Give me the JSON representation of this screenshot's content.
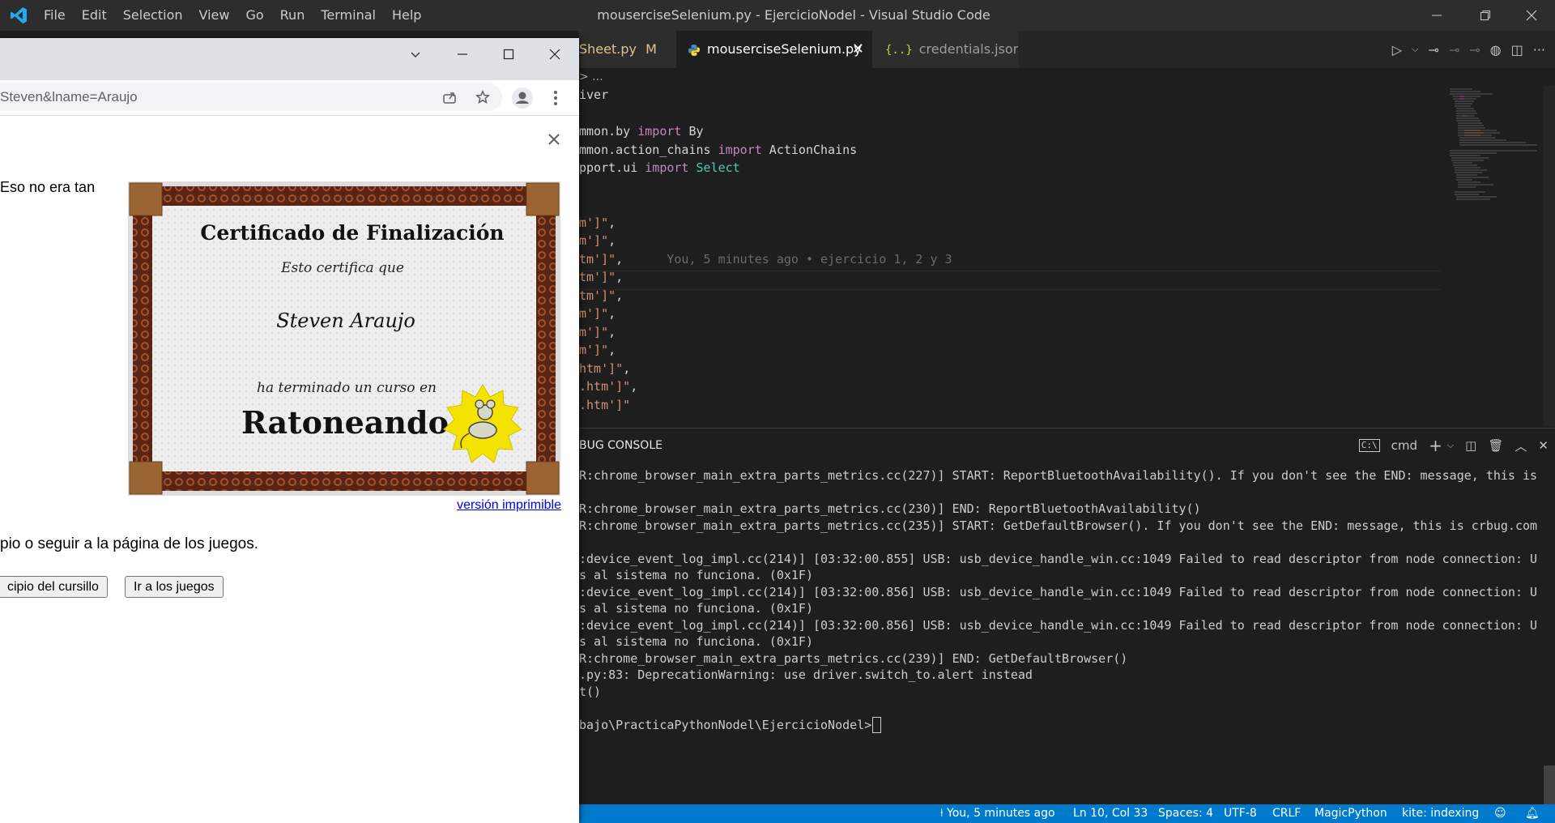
{
  "vscode": {
    "menu": [
      "File",
      "Edit",
      "Selection",
      "View",
      "Go",
      "Run",
      "Terminal",
      "Help"
    ],
    "window_title": "mouserciseSelenium.py - EjercicioNodel - Visual Studio Code",
    "tabs": [
      {
        "label": "Sheet.py",
        "badge": "M"
      },
      {
        "label": "mouserciseSelenium.py"
      },
      {
        "label": "credentials.json"
      }
    ],
    "breadcrumb": "> ...",
    "code_lines": [
      {
        "text": "iver",
        "tokens": [
          {
            "t": "iver",
            "c": ""
          }
        ]
      },
      {
        "text": "",
        "tokens": []
      },
      {
        "text": "mmon.by import By",
        "tokens": [
          {
            "t": "mmon.by ",
            "c": ""
          },
          {
            "t": "import",
            "c": "kw"
          },
          {
            "t": " By",
            "c": ""
          }
        ]
      },
      {
        "text": "mmon.action_chains import ActionChains",
        "tokens": [
          {
            "t": "mmon.action_chains ",
            "c": ""
          },
          {
            "t": "import",
            "c": "kw"
          },
          {
            "t": " ActionChains",
            "c": ""
          }
        ]
      },
      {
        "text": "pport.ui import Select",
        "tokens": [
          {
            "t": "pport.ui ",
            "c": ""
          },
          {
            "t": "import",
            "c": "kw"
          },
          {
            "t": " Select",
            "c": "cls"
          }
        ]
      },
      {
        "text": "",
        "tokens": []
      },
      {
        "text": "",
        "tokens": []
      },
      {
        "text": "m']\",",
        "tokens": [
          {
            "t": "m']\"",
            "c": "str"
          },
          {
            "t": ",",
            "c": ""
          }
        ]
      },
      {
        "text": "m']\",",
        "tokens": [
          {
            "t": "m']\"",
            "c": "str"
          },
          {
            "t": ",",
            "c": ""
          }
        ]
      },
      {
        "text": "tm']\",",
        "tokens": [
          {
            "t": "tm']\"",
            "c": "str"
          },
          {
            "t": ",",
            "c": ""
          },
          {
            "t": "      You, 5 minutes ago • ejercicio 1, 2 y 3",
            "c": "blame"
          }
        ]
      },
      {
        "text": "tm']\",",
        "tokens": [
          {
            "t": "tm']\"",
            "c": "str"
          },
          {
            "t": ",",
            "c": ""
          }
        ]
      },
      {
        "text": "tm']\",",
        "tokens": [
          {
            "t": "tm']\"",
            "c": "str"
          },
          {
            "t": ",",
            "c": ""
          }
        ]
      },
      {
        "text": "m']\",",
        "tokens": [
          {
            "t": "m']\"",
            "c": "str"
          },
          {
            "t": ",",
            "c": ""
          }
        ]
      },
      {
        "text": "m']\",",
        "tokens": [
          {
            "t": "m']\"",
            "c": "str"
          },
          {
            "t": ",",
            "c": ""
          }
        ]
      },
      {
        "text": "m']\",",
        "tokens": [
          {
            "t": "m']\"",
            "c": "str"
          },
          {
            "t": ",",
            "c": ""
          }
        ]
      },
      {
        "text": "htm']\",",
        "tokens": [
          {
            "t": "htm']\"",
            "c": "str"
          },
          {
            "t": ",",
            "c": ""
          }
        ]
      },
      {
        "text": ".htm']\",",
        "tokens": [
          {
            "t": ".htm']\"",
            "c": "str"
          },
          {
            "t": ",",
            "c": ""
          }
        ]
      },
      {
        "text": ".htm']\"",
        "tokens": [
          {
            "t": ".htm']\"",
            "c": "str"
          }
        ]
      }
    ],
    "panel_title": "BUG CONSOLE",
    "terminal_name": "cmd",
    "terminal_lines": [
      "R:chrome_browser_main_extra_parts_metrics.cc(227)] START: ReportBluetoothAvailability(). If you don't see the END: message, this is",
      "",
      "R:chrome_browser_main_extra_parts_metrics.cc(230)] END: ReportBluetoothAvailability()",
      "R:chrome_browser_main_extra_parts_metrics.cc(235)] START: GetDefaultBrowser(). If you don't see the END: message, this is crbug.com",
      "",
      ":device_event_log_impl.cc(214)] [03:32:00.855] USB: usb_device_handle_win.cc:1049 Failed to read descriptor from node connection: U",
      "s al sistema no funciona. (0x1F)",
      ":device_event_log_impl.cc(214)] [03:32:00.856] USB: usb_device_handle_win.cc:1049 Failed to read descriptor from node connection: U",
      "s al sistema no funciona. (0x1F)",
      ":device_event_log_impl.cc(214)] [03:32:00.856] USB: usb_device_handle_win.cc:1049 Failed to read descriptor from node connection: U",
      "s al sistema no funciona. (0x1F)",
      "R:chrome_browser_main_extra_parts_metrics.cc(239)] END: GetDefaultBrowser()",
      ".py:83: DeprecationWarning: use driver.switch_to.alert instead",
      "t()",
      "",
      "bajo\\PracticaPythonNodel\\EjercicioNodel>"
    ],
    "status": {
      "blame": "You, 5 minutes ago",
      "position": "Ln 10, Col 33",
      "spaces": "Spaces: 4",
      "encoding": "UTF-8",
      "eol": "CRLF",
      "language": "MagicPython",
      "kite": "kite: indexing"
    },
    "colors": {
      "statusbar": "#007acc",
      "editor_bg": "#1e1e1e",
      "keyword": "#c586c0",
      "string": "#ce9178",
      "class": "#4ec9b0"
    }
  },
  "chrome": {
    "url": "Steven&lname=Araujo",
    "intro_text": "Eso no era tan",
    "certificate": {
      "title": "Certificado de Finalización",
      "subtitle": "Esto certifica que",
      "name": "Steven Araujo",
      "line": "ha terminado un curso en",
      "course": "Ratoneando"
    },
    "printable_link": "versión imprimible",
    "page_text": "pio o seguir a la página de los juegos.",
    "buttons": {
      "start": "cipio del cursillo",
      "games": "Ir a los juegos"
    }
  }
}
